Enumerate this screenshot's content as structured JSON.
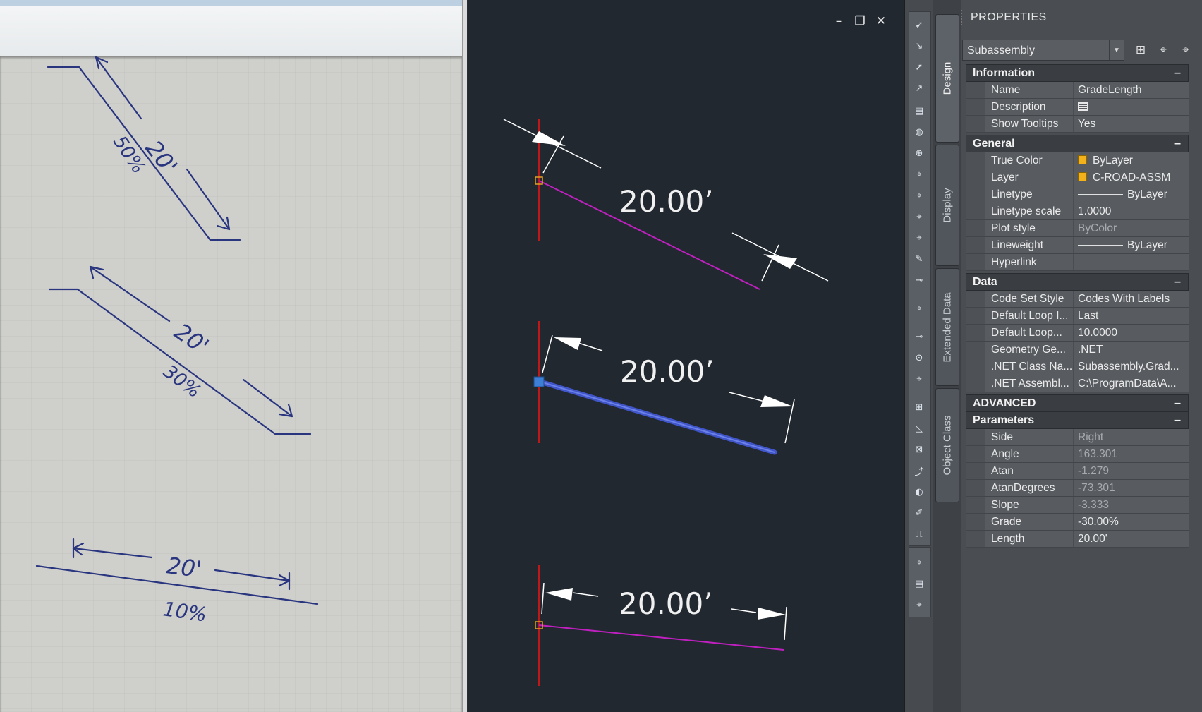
{
  "photo": {
    "annotations": [
      {
        "length": "20'",
        "grade": "50%"
      },
      {
        "length": "20'",
        "grade": "30%"
      },
      {
        "length": "20'",
        "grade": "10%"
      }
    ]
  },
  "viewport": {
    "controls": {
      "minimize": "–",
      "restore": "❐",
      "close": "✕"
    },
    "dimensions": [
      "20.00’",
      "20.00’",
      "20.00’"
    ]
  },
  "vtabs": [
    "Design",
    "Display",
    "Extended Data",
    "Object Class"
  ],
  "properties": {
    "title": "PROPERTIES",
    "selection": "Subassembly",
    "sections": {
      "information": "Information",
      "general": "General",
      "data": "Data",
      "advanced": "ADVANCED",
      "parameters": "Parameters"
    },
    "information": [
      {
        "name": "Name",
        "value": "GradeLength"
      },
      {
        "name": "Description",
        "value": ""
      },
      {
        "name": "Show Tooltips",
        "value": "Yes"
      }
    ],
    "general": [
      {
        "name": "True Color",
        "value": "ByLayer"
      },
      {
        "name": "Layer",
        "value": "C-ROAD-ASSM"
      },
      {
        "name": "Linetype",
        "value": "ByLayer"
      },
      {
        "name": "Linetype scale",
        "value": "1.0000"
      },
      {
        "name": "Plot style",
        "value": "ByColor"
      },
      {
        "name": "Lineweight",
        "value": "ByLayer"
      },
      {
        "name": "Hyperlink",
        "value": ""
      }
    ],
    "data": [
      {
        "name": "Code Set Style",
        "value": "Codes With Labels"
      },
      {
        "name": "Default Loop I...",
        "value": "Last"
      },
      {
        "name": "Default Loop...",
        "value": "10.0000"
      },
      {
        "name": "Geometry Ge...",
        "value": ".NET"
      },
      {
        "name": ".NET Class Na...",
        "value": "Subassembly.Grad..."
      },
      {
        "name": ".NET Assembl...",
        "value": "C:\\ProgramData\\A..."
      }
    ],
    "parameters": [
      {
        "name": "Side",
        "value": "Right"
      },
      {
        "name": "Angle",
        "value": "163.301"
      },
      {
        "name": "Atan",
        "value": "-1.279"
      },
      {
        "name": "AtanDegrees",
        "value": "-73.301"
      },
      {
        "name": "Slope",
        "value": "-3.333"
      },
      {
        "name": "Grade",
        "value": "-30.00%"
      },
      {
        "name": "Length",
        "value": "20.00'"
      }
    ]
  },
  "colors": {
    "ink": "#2a3580",
    "viewport_bg": "#212830",
    "magenta_line": "#c020c0",
    "selected_line": "#4055c8",
    "axis_red": "#c01818",
    "swatch": "#f3b21b"
  }
}
